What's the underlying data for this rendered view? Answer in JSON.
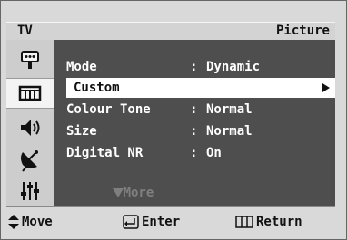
{
  "header": {
    "tv_label": "TV",
    "title": "Picture"
  },
  "sidebar": {
    "items": [
      {
        "icon": "input-icon"
      },
      {
        "icon": "picture-icon",
        "selected": true
      },
      {
        "icon": "sound-icon"
      },
      {
        "icon": "channel-icon"
      },
      {
        "icon": "setup-icon"
      }
    ]
  },
  "menu": {
    "items": [
      {
        "label": "Mode",
        "sep": ":",
        "value": "Dynamic"
      },
      {
        "label": "Custom",
        "sep": "",
        "value": "",
        "highlighted": true
      },
      {
        "label": "Colour Tone",
        "sep": ":",
        "value": "Normal"
      },
      {
        "label": "Size",
        "sep": ":",
        "value": "Normal"
      },
      {
        "label": "Digital NR",
        "sep": ":",
        "value": "On"
      }
    ],
    "more_label": "More"
  },
  "footer": {
    "move": "Move",
    "enter": "Enter",
    "return": "Return"
  },
  "colors": {
    "panel": "#4e4e4e",
    "frame": "#d9d9d9",
    "highlight": "#ffffff",
    "disabled": "#7f7f7f"
  }
}
